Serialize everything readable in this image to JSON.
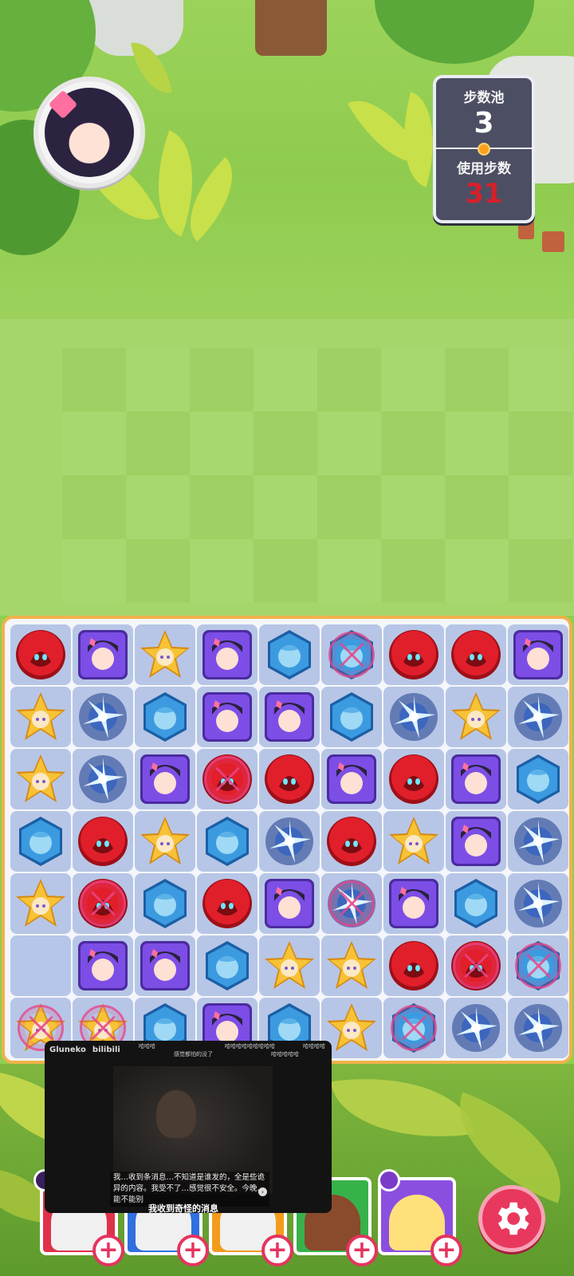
{
  "hud": {
    "pool_label": "步数池",
    "pool_value": "3",
    "used_label": "使用步数",
    "used_value": "31"
  },
  "colors": {
    "red": "#e01f2b",
    "purple": "#7d4ee6",
    "yellow": "#f7c236",
    "blue": "#3c9be0",
    "spark": "#1f3e8c",
    "board_border": "#f1b14b",
    "accent": "#e8385e"
  },
  "board": {
    "legend": "R=red blob, P=purple portrait, Y=yellow star, B=blue hexagon, S=dark lightning, E=empty; x = marked",
    "rows": [
      [
        "R",
        "P",
        "Y",
        "P",
        "B",
        "Bx",
        "R",
        "R",
        "P"
      ],
      [
        "Y",
        "S",
        "B",
        "P",
        "P",
        "B",
        "S",
        "Y",
        "S"
      ],
      [
        "Y",
        "S",
        "P",
        "Rx",
        "R",
        "P",
        "R",
        "P",
        "B"
      ],
      [
        "B",
        "R",
        "Y",
        "B",
        "S",
        "R",
        "Y",
        "P",
        "S"
      ],
      [
        "Y",
        "Rx",
        "B",
        "R",
        "P",
        "Sx",
        "P",
        "B",
        "S"
      ],
      [
        "E",
        "P",
        "P",
        "B",
        "Y",
        "Y",
        "R",
        "Rx",
        "Bx"
      ],
      [
        "Yx",
        "Yx",
        "B",
        "P",
        "B",
        "Y",
        "Bx",
        "S",
        "S"
      ]
    ]
  },
  "video": {
    "brand": "Gluneko",
    "platform": "bilibili",
    "danmaku_1": "哈哈哈",
    "danmaku_2": "感觉都怕的没了",
    "danmaku_3": "哈哈哈哈哈哈哈哈哈",
    "danmaku_4": "哈哈哈哈",
    "danmaku_5": "哈哈哈哈哈",
    "caption": "我…收到条消息…不知道是谁发的，全是些诡异的内容。我受不了…感觉很不安全。今晚…能不能别",
    "title": "我收到奇怪的消息"
  },
  "heroes": [
    {
      "name": "hero-1",
      "color": "#e0314a"
    },
    {
      "name": "hero-2",
      "color": "#2f6fe0"
    },
    {
      "name": "hero-3",
      "color": "#f39c1c"
    },
    {
      "name": "hero-4",
      "color": "#37b24a"
    },
    {
      "name": "hero-5",
      "color": "#8b4fe0"
    }
  ],
  "icons": {
    "settings": "gear-icon",
    "add": "plus-icon",
    "avatar": "player-avatar"
  }
}
